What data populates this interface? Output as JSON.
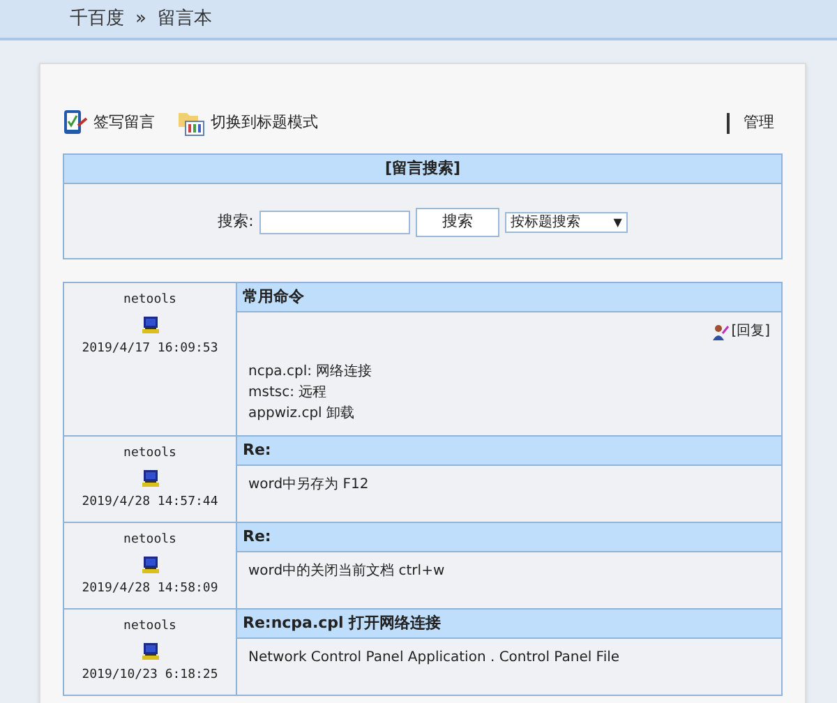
{
  "breadcrumb": {
    "site": "千百度",
    "separator": "»",
    "page": "留言本"
  },
  "toolbar": {
    "write": "签写留言",
    "switch": "切换到标题模式",
    "admin": "管理"
  },
  "search": {
    "title": "[留言搜索]",
    "label": "搜索:",
    "button": "搜索",
    "mode": "按标题搜索",
    "caret": "▼"
  },
  "posts": [
    {
      "author": "netools",
      "time": "2019/4/17 16:09:53",
      "title": "常用命令",
      "reply": "[回复]",
      "lines": [
        "ncpa.cpl: 网络连接",
        "mstsc: 远程",
        "appwiz.cpl 卸载"
      ]
    },
    {
      "author": "netools",
      "time": "2019/4/28 14:57:44",
      "title": "Re:",
      "lines": [
        "word中另存为 F12"
      ]
    },
    {
      "author": "netools",
      "time": "2019/4/28 14:58:09",
      "title": "Re:",
      "lines": [
        "word中的关闭当前文档 ctrl+w"
      ]
    },
    {
      "author": "netools",
      "time": "2019/10/23 6:18:25",
      "title": "Re:ncpa.cpl 打开网络连接",
      "lines": [
        "Network Control Panel Application . Control Panel File"
      ]
    }
  ]
}
